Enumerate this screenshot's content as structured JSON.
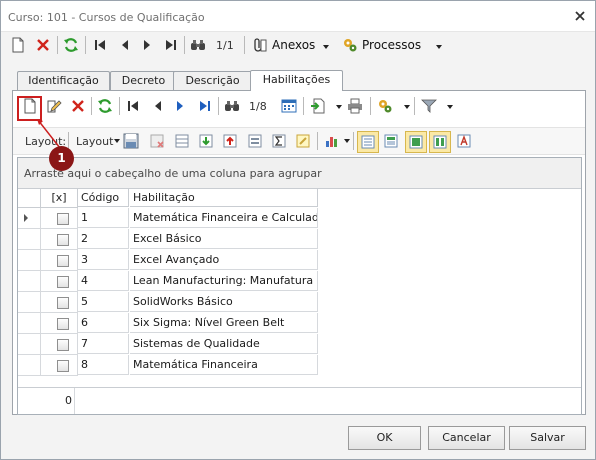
{
  "window": {
    "title": "Curso: 101 - Cursos de Qualificação"
  },
  "toolbar1": {
    "record_counter": "1/1",
    "annexes_label": "Anexos",
    "processes_label": "Processos"
  },
  "tabs": [
    {
      "label": "Identificação",
      "active": false
    },
    {
      "label": "Decreto",
      "active": false
    },
    {
      "label": "Descrição",
      "active": false
    },
    {
      "label": "Habilitações",
      "active": true
    }
  ],
  "toolbar2": {
    "record_counter": "1/8"
  },
  "toolbar3": {
    "layout_label": "Layout:",
    "layout_dropdown": "Layout"
  },
  "grid": {
    "group_hint": "Arraste aqui o cabeçalho de uma coluna para agrupar",
    "columns": [
      "[x]",
      "Código",
      "Habilitação"
    ],
    "rows": [
      {
        "code": "1",
        "name": "Matemática Financeira e Calculador..."
      },
      {
        "code": "2",
        "name": "Excel Básico"
      },
      {
        "code": "3",
        "name": "Excel Avançado"
      },
      {
        "code": "4",
        "name": "Lean Manufacturing: Manufatura E..."
      },
      {
        "code": "5",
        "name": "SolidWorks Básico"
      },
      {
        "code": "6",
        "name": "Six Sigma: Nível Green Belt"
      },
      {
        "code": "7",
        "name": "Sistemas de Qualidade"
      },
      {
        "code": "8",
        "name": "Matemática Financeira"
      }
    ],
    "footer_count": "0"
  },
  "buttons": {
    "ok": "OK",
    "cancel": "Cancelar",
    "save": "Salvar"
  },
  "annotation": {
    "number": "1",
    "color": "#cc1f1f"
  },
  "colors": {
    "accent_blue": "#1f5fbf",
    "delete_red": "#d0241b",
    "refresh_green": "#2e9b2e"
  }
}
